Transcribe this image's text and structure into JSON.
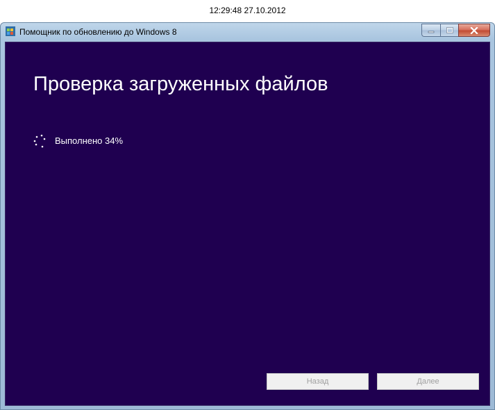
{
  "clock": {
    "timestamp": "12:29:48 27.10.2012"
  },
  "window": {
    "title": "Помощник по обновлению до Windows 8",
    "controls": {
      "minimize_icon": "minimize-icon",
      "maximize_icon": "maximize-icon",
      "close_icon": "close-icon"
    }
  },
  "main": {
    "heading": "Проверка загруженных файлов",
    "progress_text": "Выполнено 34%",
    "progress_percent": 34
  },
  "buttons": {
    "back_label": "Назад",
    "next_label": "Далее"
  },
  "colors": {
    "background": "#1f0050",
    "text": "#ffffff",
    "button_disabled_text": "#a0a0a0"
  }
}
